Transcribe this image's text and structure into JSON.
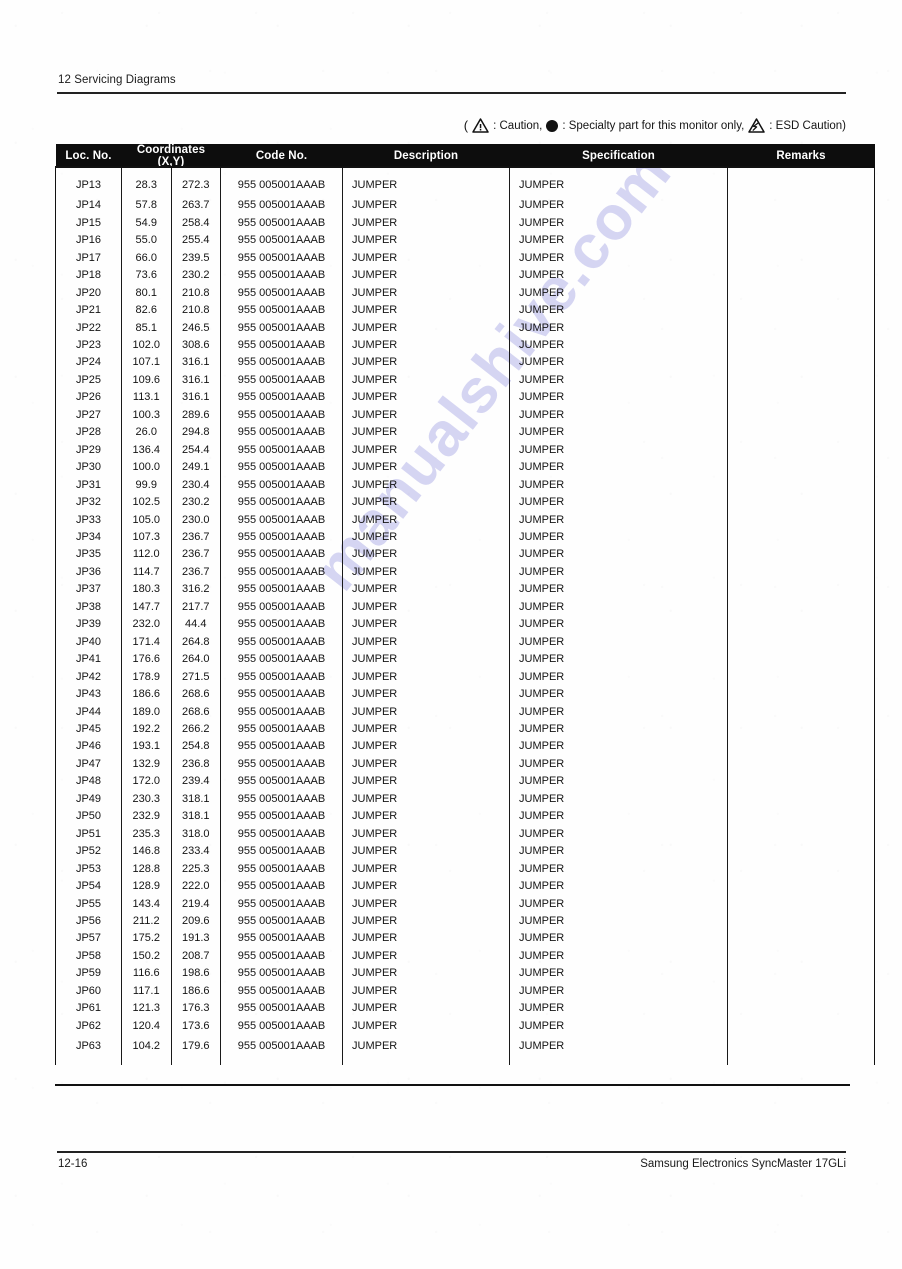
{
  "running_head": "12 Servicing Diagrams",
  "legend": {
    "open_paren": "(",
    "caution_icon": "warning-triangle-icon",
    "caution_label": ": Caution,",
    "specialty_icon": "filled-circle-icon",
    "specialty_label": ": Specialty part for this monitor only,",
    "esd_icon": "esd-triangle-icon",
    "esd_label": ": ESD Caution)"
  },
  "table": {
    "headers": {
      "loc_no": "Loc. No.",
      "coordinates": "Coordinates (X,Y)",
      "code_no": "Code No.",
      "description": "Description",
      "specification": "Specification",
      "remarks": "Remarks"
    },
    "rows": [
      {
        "loc": "JP13",
        "x": "28.3",
        "y": "272.3",
        "code": "955 005001AAAB",
        "desc": "JUMPER",
        "spec": "JUMPER",
        "rmk": ""
      },
      {
        "loc": "JP14",
        "x": "57.8",
        "y": "263.7",
        "code": "955 005001AAAB",
        "desc": "JUMPER",
        "spec": "JUMPER",
        "rmk": ""
      },
      {
        "loc": "JP15",
        "x": "54.9",
        "y": "258.4",
        "code": "955 005001AAAB",
        "desc": "JUMPER",
        "spec": "JUMPER",
        "rmk": ""
      },
      {
        "loc": "JP16",
        "x": "55.0",
        "y": "255.4",
        "code": "955 005001AAAB",
        "desc": "JUMPER",
        "spec": "JUMPER",
        "rmk": ""
      },
      {
        "loc": "JP17",
        "x": "66.0",
        "y": "239.5",
        "code": "955 005001AAAB",
        "desc": "JUMPER",
        "spec": "JUMPER",
        "rmk": ""
      },
      {
        "loc": "JP18",
        "x": "73.6",
        "y": "230.2",
        "code": "955 005001AAAB",
        "desc": "JUMPER",
        "spec": "JUMPER",
        "rmk": ""
      },
      {
        "loc": "JP20",
        "x": "80.1",
        "y": "210.8",
        "code": "955 005001AAAB",
        "desc": "JUMPER",
        "spec": "JUMPER",
        "rmk": ""
      },
      {
        "loc": "JP21",
        "x": "82.6",
        "y": "210.8",
        "code": "955 005001AAAB",
        "desc": "JUMPER",
        "spec": "JUMPER",
        "rmk": ""
      },
      {
        "loc": "JP22",
        "x": "85.1",
        "y": "246.5",
        "code": "955 005001AAAB",
        "desc": "JUMPER",
        "spec": "JUMPER",
        "rmk": ""
      },
      {
        "loc": "JP23",
        "x": "102.0",
        "y": "308.6",
        "code": "955 005001AAAB",
        "desc": "JUMPER",
        "spec": "JUMPER",
        "rmk": ""
      },
      {
        "loc": "JP24",
        "x": "107.1",
        "y": "316.1",
        "code": "955 005001AAAB",
        "desc": "JUMPER",
        "spec": "JUMPER",
        "rmk": ""
      },
      {
        "loc": "JP25",
        "x": "109.6",
        "y": "316.1",
        "code": "955 005001AAAB",
        "desc": "JUMPER",
        "spec": "JUMPER",
        "rmk": ""
      },
      {
        "loc": "JP26",
        "x": "113.1",
        "y": "316.1",
        "code": "955 005001AAAB",
        "desc": "JUMPER",
        "spec": "JUMPER",
        "rmk": ""
      },
      {
        "loc": "JP27",
        "x": "100.3",
        "y": "289.6",
        "code": "955 005001AAAB",
        "desc": "JUMPER",
        "spec": "JUMPER",
        "rmk": ""
      },
      {
        "loc": "JP28",
        "x": "26.0",
        "y": "294.8",
        "code": "955 005001AAAB",
        "desc": "JUMPER",
        "spec": "JUMPER",
        "rmk": ""
      },
      {
        "loc": "JP29",
        "x": "136.4",
        "y": "254.4",
        "code": "955 005001AAAB",
        "desc": "JUMPER",
        "spec": "JUMPER",
        "rmk": ""
      },
      {
        "loc": "JP30",
        "x": "100.0",
        "y": "249.1",
        "code": "955 005001AAAB",
        "desc": "JUMPER",
        "spec": "JUMPER",
        "rmk": ""
      },
      {
        "loc": "JP31",
        "x": "99.9",
        "y": "230.4",
        "code": "955 005001AAAB",
        "desc": "JUMPER",
        "spec": "JUMPER",
        "rmk": ""
      },
      {
        "loc": "JP32",
        "x": "102.5",
        "y": "230.2",
        "code": "955 005001AAAB",
        "desc": "JUMPER",
        "spec": "JUMPER",
        "rmk": ""
      },
      {
        "loc": "JP33",
        "x": "105.0",
        "y": "230.0",
        "code": "955 005001AAAB",
        "desc": "JUMPER",
        "spec": "JUMPER",
        "rmk": ""
      },
      {
        "loc": "JP34",
        "x": "107.3",
        "y": "236.7",
        "code": "955 005001AAAB",
        "desc": "JUMPER",
        "spec": "JUMPER",
        "rmk": ""
      },
      {
        "loc": "JP35",
        "x": "112.0",
        "y": "236.7",
        "code": "955 005001AAAB",
        "desc": "JUMPER",
        "spec": "JUMPER",
        "rmk": ""
      },
      {
        "loc": "JP36",
        "x": "114.7",
        "y": "236.7",
        "code": "955 005001AAAB",
        "desc": "JUMPER",
        "spec": "JUMPER",
        "rmk": ""
      },
      {
        "loc": "JP37",
        "x": "180.3",
        "y": "316.2",
        "code": "955 005001AAAB",
        "desc": "JUMPER",
        "spec": "JUMPER",
        "rmk": ""
      },
      {
        "loc": "JP38",
        "x": "147.7",
        "y": "217.7",
        "code": "955 005001AAAB",
        "desc": "JUMPER",
        "spec": "JUMPER",
        "rmk": ""
      },
      {
        "loc": "JP39",
        "x": "232.0",
        "y": "44.4",
        "code": "955 005001AAAB",
        "desc": "JUMPER",
        "spec": "JUMPER",
        "rmk": ""
      },
      {
        "loc": "JP40",
        "x": "171.4",
        "y": "264.8",
        "code": "955 005001AAAB",
        "desc": "JUMPER",
        "spec": "JUMPER",
        "rmk": ""
      },
      {
        "loc": "JP41",
        "x": "176.6",
        "y": "264.0",
        "code": "955 005001AAAB",
        "desc": "JUMPER",
        "spec": "JUMPER",
        "rmk": ""
      },
      {
        "loc": "JP42",
        "x": "178.9",
        "y": "271.5",
        "code": "955 005001AAAB",
        "desc": "JUMPER",
        "spec": "JUMPER",
        "rmk": ""
      },
      {
        "loc": "JP43",
        "x": "186.6",
        "y": "268.6",
        "code": "955 005001AAAB",
        "desc": "JUMPER",
        "spec": "JUMPER",
        "rmk": ""
      },
      {
        "loc": "JP44",
        "x": "189.0",
        "y": "268.6",
        "code": "955 005001AAAB",
        "desc": "JUMPER",
        "spec": "JUMPER",
        "rmk": ""
      },
      {
        "loc": "JP45",
        "x": "192.2",
        "y": "266.2",
        "code": "955 005001AAAB",
        "desc": "JUMPER",
        "spec": "JUMPER",
        "rmk": ""
      },
      {
        "loc": "JP46",
        "x": "193.1",
        "y": "254.8",
        "code": "955 005001AAAB",
        "desc": "JUMPER",
        "spec": "JUMPER",
        "rmk": ""
      },
      {
        "loc": "JP47",
        "x": "132.9",
        "y": "236.8",
        "code": "955 005001AAAB",
        "desc": "JUMPER",
        "spec": "JUMPER",
        "rmk": ""
      },
      {
        "loc": "JP48",
        "x": "172.0",
        "y": "239.4",
        "code": "955 005001AAAB",
        "desc": "JUMPER",
        "spec": "JUMPER",
        "rmk": ""
      },
      {
        "loc": "JP49",
        "x": "230.3",
        "y": "318.1",
        "code": "955 005001AAAB",
        "desc": "JUMPER",
        "spec": "JUMPER",
        "rmk": ""
      },
      {
        "loc": "JP50",
        "x": "232.9",
        "y": "318.1",
        "code": "955 005001AAAB",
        "desc": "JUMPER",
        "spec": "JUMPER",
        "rmk": ""
      },
      {
        "loc": "JP51",
        "x": "235.3",
        "y": "318.0",
        "code": "955 005001AAAB",
        "desc": "JUMPER",
        "spec": "JUMPER",
        "rmk": ""
      },
      {
        "loc": "JP52",
        "x": "146.8",
        "y": "233.4",
        "code": "955 005001AAAB",
        "desc": "JUMPER",
        "spec": "JUMPER",
        "rmk": ""
      },
      {
        "loc": "JP53",
        "x": "128.8",
        "y": "225.3",
        "code": "955 005001AAAB",
        "desc": "JUMPER",
        "spec": "JUMPER",
        "rmk": ""
      },
      {
        "loc": "JP54",
        "x": "128.9",
        "y": "222.0",
        "code": "955 005001AAAB",
        "desc": "JUMPER",
        "spec": "JUMPER",
        "rmk": ""
      },
      {
        "loc": "JP55",
        "x": "143.4",
        "y": "219.4",
        "code": "955 005001AAAB",
        "desc": "JUMPER",
        "spec": "JUMPER",
        "rmk": ""
      },
      {
        "loc": "JP56",
        "x": "211.2",
        "y": "209.6",
        "code": "955 005001AAAB",
        "desc": "JUMPER",
        "spec": "JUMPER",
        "rmk": ""
      },
      {
        "loc": "JP57",
        "x": "175.2",
        "y": "191.3",
        "code": "955 005001AAAB",
        "desc": "JUMPER",
        "spec": "JUMPER",
        "rmk": ""
      },
      {
        "loc": "JP58",
        "x": "150.2",
        "y": "208.7",
        "code": "955 005001AAAB",
        "desc": "JUMPER",
        "spec": "JUMPER",
        "rmk": ""
      },
      {
        "loc": "JP59",
        "x": "116.6",
        "y": "198.6",
        "code": "955 005001AAAB",
        "desc": "JUMPER",
        "spec": "JUMPER",
        "rmk": ""
      },
      {
        "loc": "JP60",
        "x": "117.1",
        "y": "186.6",
        "code": "955 005001AAAB",
        "desc": "JUMPER",
        "spec": "JUMPER",
        "rmk": ""
      },
      {
        "loc": "JP61",
        "x": "121.3",
        "y": "176.3",
        "code": "955 005001AAAB",
        "desc": "JUMPER",
        "spec": "JUMPER",
        "rmk": ""
      },
      {
        "loc": "JP62",
        "x": "120.4",
        "y": "173.6",
        "code": "955 005001AAAB",
        "desc": "JUMPER",
        "spec": "JUMPER",
        "rmk": ""
      },
      {
        "loc": "JP63",
        "x": "104.2",
        "y": "179.6",
        "code": "955 005001AAAB",
        "desc": "JUMPER",
        "spec": "JUMPER",
        "rmk": ""
      }
    ]
  },
  "footer": {
    "page_number": "12-16",
    "product": "Samsung Electronics SyncMaster 17GLi"
  },
  "watermark": {
    "text": "manualshive.com"
  }
}
